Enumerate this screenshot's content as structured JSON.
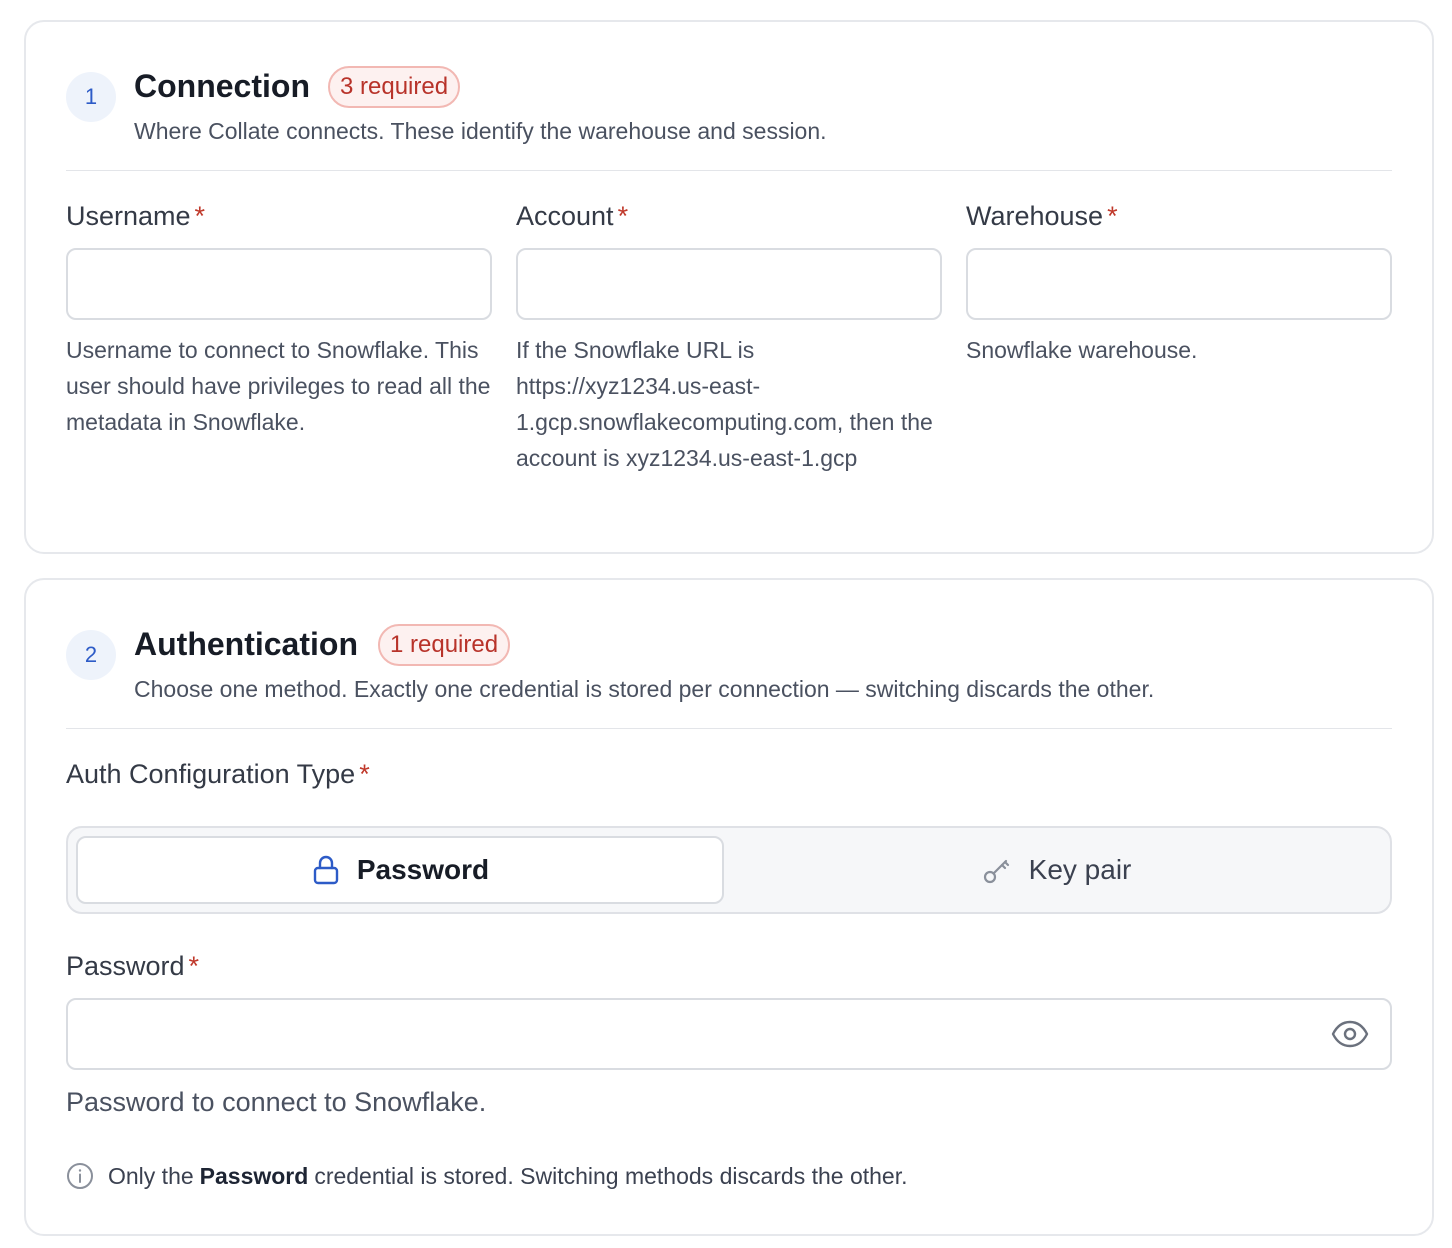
{
  "connection": {
    "step": "1",
    "title": "Connection",
    "badge": "3 required",
    "description": "Where Collate connects. These identify the warehouse and session.",
    "fields": [
      {
        "label": "Username",
        "required_mark": "*",
        "value": "",
        "help": "Username to connect to Snowflake. This user should have privileges to read all the metadata in Snowflake."
      },
      {
        "label": "Account",
        "required_mark": "*",
        "value": "",
        "help": "If the Snowflake URL is https://xyz1234.us-east-1.gcp.snowflakecomputing.com, then the account is xyz1234.us-east-1.gcp"
      },
      {
        "label": "Warehouse",
        "required_mark": "*",
        "value": "",
        "help": "Snowflake warehouse."
      }
    ]
  },
  "authentication": {
    "step": "2",
    "title": "Authentication",
    "badge": "1 required",
    "description": "Choose one method. Exactly one credential is stored per connection — switching discards the other.",
    "auth_type_label": "Auth Configuration Type",
    "required_mark": "*",
    "options": [
      {
        "label": "Password",
        "icon": "lock-icon",
        "selected": true
      },
      {
        "label": "Key pair",
        "icon": "key-icon",
        "selected": false
      }
    ],
    "password": {
      "label": "Password",
      "required_mark": "*",
      "value": "",
      "help": "Password to connect to Snowflake.",
      "toggle_icon": "eye-icon"
    },
    "note": {
      "icon": "info-icon",
      "prefix": "Only the",
      "bold": "Password",
      "suffix": "credential is stored. Switching methods discards the other."
    }
  },
  "colors": {
    "accent": "#2d5bc7",
    "required_red": "#c0392b",
    "badge_bg": "#fdf1f0",
    "border": "#e6e8ec"
  }
}
